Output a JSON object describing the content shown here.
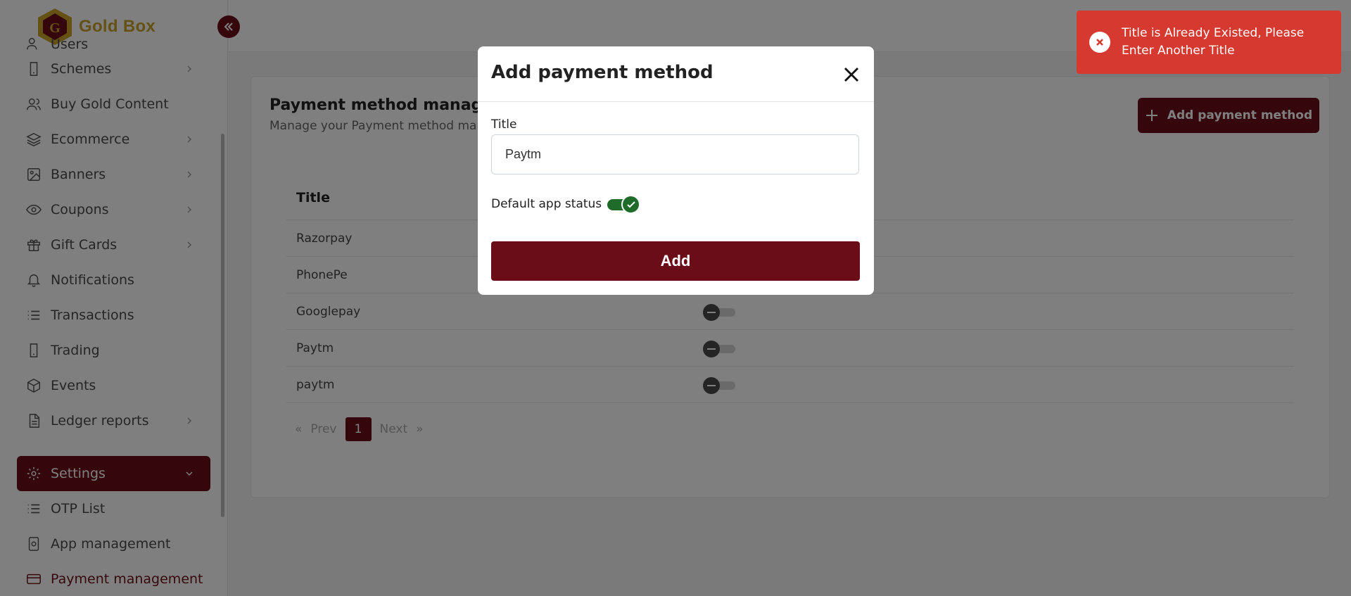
{
  "app": {
    "name": "Gold Box",
    "brand_color": "#6b0d18",
    "accent_gold": "#c9a227"
  },
  "sidebar": {
    "items": [
      {
        "label": "Users",
        "icon": "users-icon",
        "has_submenu": true
      },
      {
        "label": "Schemes",
        "icon": "phone-icon",
        "has_submenu": true
      },
      {
        "label": "Buy Gold Content",
        "icon": "user-icon",
        "has_submenu": false
      },
      {
        "label": "Ecommerce",
        "icon": "layers-icon",
        "has_submenu": true
      },
      {
        "label": "Banners",
        "icon": "image-icon",
        "has_submenu": true
      },
      {
        "label": "Coupons",
        "icon": "eye-icon",
        "has_submenu": true
      },
      {
        "label": "Gift Cards",
        "icon": "gift-icon",
        "has_submenu": true
      },
      {
        "label": "Notifications",
        "icon": "bell-icon",
        "has_submenu": false
      },
      {
        "label": "Transactions",
        "icon": "list-icon",
        "has_submenu": false
      },
      {
        "label": "Trading",
        "icon": "phone-icon",
        "has_submenu": false
      },
      {
        "label": "Events",
        "icon": "box-icon",
        "has_submenu": false
      },
      {
        "label": "Ledger reports",
        "icon": "file-icon",
        "has_submenu": true
      },
      {
        "label": "Settings",
        "icon": "gear-icon",
        "has_submenu": true,
        "active": true
      },
      {
        "label": "OTP List",
        "icon": "list-icon",
        "has_submenu": false
      },
      {
        "label": "App management",
        "icon": "app-icon",
        "has_submenu": false
      },
      {
        "label": "Payment management",
        "icon": "card-icon",
        "has_submenu": false,
        "current": true
      }
    ]
  },
  "page": {
    "title": "Payment method management",
    "subtitle": "Manage your Payment method management",
    "add_button_label": "Add payment method",
    "table": {
      "column_title": "Title",
      "rows": [
        {
          "title": "Razorpay",
          "status": false
        },
        {
          "title": "PhonePe",
          "status": false
        },
        {
          "title": "Googlepay",
          "status": false
        },
        {
          "title": "Paytm",
          "status": false
        },
        {
          "title": "paytm",
          "status": false
        }
      ]
    },
    "pagination": {
      "prev": "Prev",
      "next": "Next",
      "current_page": "1",
      "first_symbol": "«",
      "last_symbol": "»"
    }
  },
  "modal": {
    "title": "Add payment method",
    "field_label": "Title",
    "field_value": "Paytm",
    "status_label": "Default app status",
    "status_on": true,
    "submit_label": "Add"
  },
  "toast": {
    "message": "Title is Already Existed, Please Enter Another Title",
    "type": "error",
    "color": "#d6392f"
  }
}
